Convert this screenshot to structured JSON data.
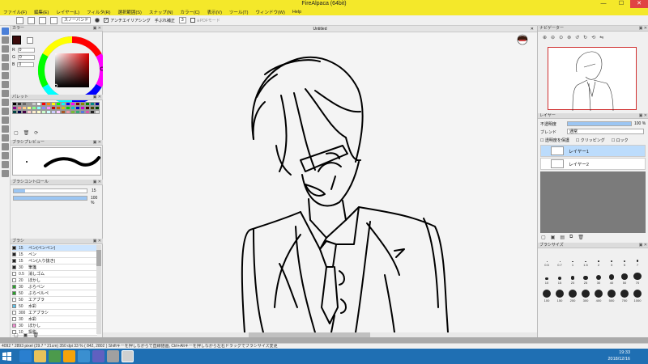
{
  "window": {
    "title": "FireAlpaca (64bit)",
    "min": "—",
    "max": "☐",
    "close": "✕"
  },
  "menu": [
    "ファイル(F)",
    "編集(E)",
    "レイヤー(L)",
    "フィルタ(R)",
    "選択範囲(S)",
    "スナップ(N)",
    "カラー(C)",
    "表示(V)",
    "ツール(T)",
    "ウィンドウ(W)",
    "Help"
  ],
  "toolbar": {
    "snap_mode": "スノーバンド",
    "antialias_label": "アンチエイリアシング",
    "correction_label": "手ぶれ補正",
    "correction_value": "3",
    "pdf_label": "※PDFモード"
  },
  "color_panel": {
    "title": "カラー",
    "r_label": "R",
    "r_value": "0",
    "g_label": "G",
    "g_value": "0",
    "b_label": "B",
    "b_value": "0"
  },
  "palette_panel": {
    "title": "パレット"
  },
  "brush_preview_panel": {
    "title": "ブラシプレビュー"
  },
  "brush_control_panel": {
    "title": "ブラシコントロール",
    "size_value": "15",
    "opacity_value": "100 %",
    "size_fraction": 0.15,
    "opacity_fraction": 1.0
  },
  "brush_panel": {
    "title": "ブラシ",
    "items": [
      {
        "size": "15",
        "name": "ペン(ペンペン)",
        "color": "#1a1a1a"
      },
      {
        "size": "15",
        "name": "ペン",
        "color": "#222222"
      },
      {
        "size": "15",
        "name": "ペン(入り抜き)",
        "color": "#222222"
      },
      {
        "size": "30",
        "name": "筆箋",
        "color": "#222222"
      },
      {
        "size": "0.5",
        "name": "消しゴム",
        "color": "#ffffff"
      },
      {
        "size": "20",
        "name": "ぼかし",
        "color": "#ffffff"
      },
      {
        "size": "30",
        "name": "ぶらペン",
        "color": "#2aa02a"
      },
      {
        "size": "50",
        "name": "ぶらペルペ",
        "color": "#2aa02a"
      },
      {
        "size": "50",
        "name": "エアブラ",
        "color": "#ffffff"
      },
      {
        "size": "50",
        "name": "水彩",
        "color": "#62c2e8"
      },
      {
        "size": "300",
        "name": "エアブラシ",
        "color": "#ffffff"
      },
      {
        "size": "30",
        "name": "水彩",
        "color": "#ffffff"
      },
      {
        "size": "30",
        "name": "ぼかし",
        "color": "#f08cd0"
      },
      {
        "size": "10",
        "name": "投影",
        "color": "#ffffff"
      }
    ]
  },
  "canvas": {
    "tab_title": "Untitled",
    "close": "✕"
  },
  "navigator": {
    "title": "ナビゲーター"
  },
  "layer_panel": {
    "title": "レイヤー",
    "opacity_label": "不透明度",
    "opacity_value": "100 %",
    "opacity_fraction": 1.0,
    "blend_label": "ブレンド",
    "blend_value": "通常",
    "protect_label": "透明度を保護",
    "clipping_label": "クリッピング",
    "lock_label": "ロック",
    "layers": [
      {
        "name": "レイヤー1"
      },
      {
        "name": "レイヤー2"
      }
    ]
  },
  "brush_size_panel": {
    "title": "ブラシサイズ",
    "sizes": [
      "0.5",
      "0.7",
      "1",
      "1.5",
      "2",
      "3",
      "5",
      "7",
      "10",
      "15",
      "20",
      "25",
      "30",
      "40",
      "50",
      "70",
      "100",
      "150",
      "200",
      "300",
      "400",
      "500",
      "700",
      "1000"
    ]
  },
  "status": {
    "text": "4092 * 2893 pixel  (29.7 * 21cm)  350 dpi  33 %  ( 842, 2802 )  Shiftキーを押しながらで直線描画, Ctrl+Altキーを押しながら左右ドラッグでブラシサイズ変更"
  },
  "taskbar": {
    "time": "19:33",
    "date": "2018/12/16"
  }
}
